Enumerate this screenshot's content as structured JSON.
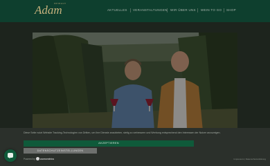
{
  "brand": {
    "small": "WEINGUT",
    "name": "Adam"
  },
  "nav": {
    "items": [
      "Aktuelles",
      "Veranstaltungen",
      "Wir über uns",
      "Wein to go",
      "Shop"
    ]
  },
  "hero": {
    "icon": "photo"
  },
  "cookie": {
    "text": "Diese Seite nutzt Website Tracking-Technologien von Dritten, um ihre Dienste anzubieten, stetig zu verbessern und Werbung entsprechend den Interessen der Nutzer anzuzeigen.",
    "accept_label": "Akzeptieren",
    "settings_label": "Datenschutzeinstellungen",
    "powered_label": "Powered by",
    "powered_brand": "usercentrics",
    "legal": "Impressum | Datenschutzerklärung"
  },
  "colors": {
    "header": "#0e3f2e",
    "accent": "#0f5a3a",
    "gold": "#c7b27d"
  }
}
